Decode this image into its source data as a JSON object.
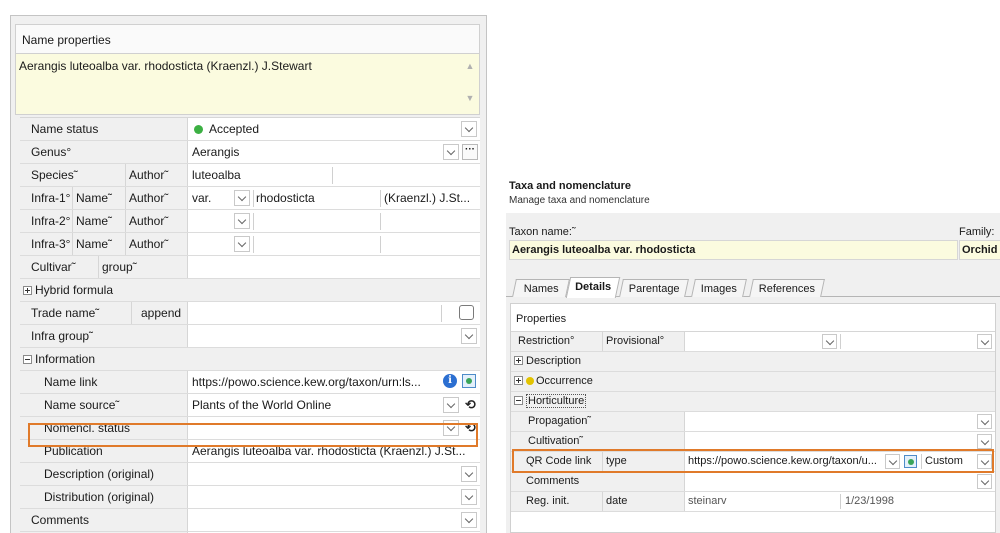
{
  "left": {
    "header": "Name properties",
    "full_name": "Aerangis luteoalba var. rhodosticta (Kraenzl.) J.Stewart",
    "rows": {
      "name_status": {
        "label": "Name status",
        "value": "Accepted",
        "status_color": "#3cb043"
      },
      "genus": {
        "label": "Genus°",
        "value": "Aerangis"
      },
      "species": {
        "label": "Species˜",
        "author_label": "Author˜",
        "value": "luteoalba"
      },
      "infra1": {
        "label": "Infra-1°",
        "name_label": "Name˜",
        "author_label": "Author˜",
        "rank": "var.",
        "name": "rhodosticta",
        "author": "(Kraenzl.) J.St..."
      },
      "infra2": {
        "label": "Infra-2°",
        "name_label": "Name˜",
        "author_label": "Author˜"
      },
      "infra3": {
        "label": "Infra-3°",
        "name_label": "Name˜",
        "author_label": "Author˜"
      },
      "cultivar": {
        "label": "Cultivar˜",
        "group_label": "group˜"
      },
      "hybrid": {
        "label": "Hybrid formula"
      },
      "trade_name": {
        "label": "Trade name˜",
        "append_label": "append"
      },
      "infra_group": {
        "label": "Infra group˜"
      },
      "information": {
        "label": "Information"
      },
      "name_link": {
        "label": "Name link",
        "value": "https://powo.science.kew.org/taxon/urn:ls..."
      },
      "name_source": {
        "label": "Name source˜",
        "value": "Plants of the World Online"
      },
      "nomencl_status": {
        "label": "Nomencl. status˜"
      },
      "publication": {
        "label": "Publication",
        "value": "Aerangis luteoalba var. rhodosticta (Kraenzl.) J.St..."
      },
      "description": {
        "label": "Description (original)"
      },
      "distribution": {
        "label": "Distribution (original)"
      },
      "comments": {
        "label": "Comments"
      }
    }
  },
  "right": {
    "title": "Taxa and nomenclature",
    "subtitle": "Manage taxa and nomenclature",
    "taxon_label": "Taxon name:˜",
    "taxon_value": "Aerangis luteoalba var. rhodosticta",
    "family_label": "Family:",
    "family_value": "Orchid",
    "tabs": [
      "Names",
      "Details",
      "Parentage",
      "Images",
      "References"
    ],
    "active_tab": "Details",
    "properties_label": "Properties",
    "rows": {
      "restriction": {
        "label": "Restriction°",
        "label2": "Provisional°"
      },
      "description": {
        "label": "Description"
      },
      "occurrence": {
        "label": "Occurrence"
      },
      "horticulture": {
        "label": "Horticulture"
      },
      "propagation": {
        "label": "Propagation˜"
      },
      "cultivation": {
        "label": "Cultivation˜"
      },
      "qr_code": {
        "label": "QR Code link",
        "label2": "type",
        "value": "https://powo.science.kew.org/taxon/u...",
        "type_value": "Custom"
      },
      "comments": {
        "label": "Comments"
      },
      "reg_init": {
        "label": "Reg. init.",
        "label2": "date",
        "value": "steinarv",
        "date": "1/23/1998"
      }
    }
  },
  "highlight_color": "#e07a2a"
}
